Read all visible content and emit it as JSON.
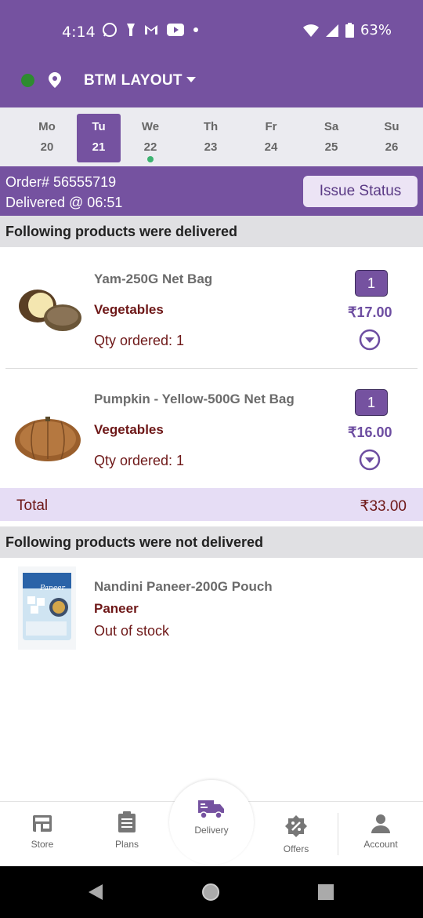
{
  "status_bar": {
    "time": "4:14",
    "battery": "63%"
  },
  "header": {
    "location": "BTM LAYOUT"
  },
  "calendar": [
    {
      "day": "Mo",
      "date": "20",
      "selected": false,
      "has_delivery": false
    },
    {
      "day": "Tu",
      "date": "21",
      "selected": true,
      "has_delivery": false
    },
    {
      "day": "We",
      "date": "22",
      "selected": false,
      "has_delivery": true
    },
    {
      "day": "Th",
      "date": "23",
      "selected": false,
      "has_delivery": false
    },
    {
      "day": "Fr",
      "date": "24",
      "selected": false,
      "has_delivery": false
    },
    {
      "day": "Sa",
      "date": "25",
      "selected": false,
      "has_delivery": false
    },
    {
      "day": "Su",
      "date": "26",
      "selected": false,
      "has_delivery": false
    }
  ],
  "order": {
    "number": "Order# 56555719",
    "delivered": "Delivered @ 06:51",
    "issue_button": "Issue Status"
  },
  "delivered_section": {
    "title": "Following products were delivered",
    "items": [
      {
        "name": "Yam-250G Net Bag",
        "category": "Vegetables",
        "qty_ordered": "Qty ordered: 1",
        "qty": "1",
        "price": "₹17.00"
      },
      {
        "name": "Pumpkin - Yellow-500G Net Bag",
        "category": "Vegetables",
        "qty_ordered": "Qty ordered: 1",
        "qty": "1",
        "price": "₹16.00"
      }
    ]
  },
  "total": {
    "label": "Total",
    "value": "₹33.00"
  },
  "not_delivered_section": {
    "title": "Following products were not delivered",
    "items": [
      {
        "name": "Nandini Paneer-200G Pouch",
        "category": "Paneer",
        "status": "Out of stock",
        "package_text": "Paneer"
      }
    ]
  },
  "bottom_nav": [
    {
      "label": "Store",
      "icon": "store-icon"
    },
    {
      "label": "Plans",
      "icon": "clipboard-icon"
    },
    {
      "label": "Delivery",
      "icon": "truck-icon"
    },
    {
      "label": "Offers",
      "icon": "discount-icon"
    },
    {
      "label": "Account",
      "icon": "person-icon"
    }
  ],
  "colors": {
    "primary": "#7552a0",
    "accent_text": "#6e1818",
    "highlight": "#e6ddf5"
  }
}
